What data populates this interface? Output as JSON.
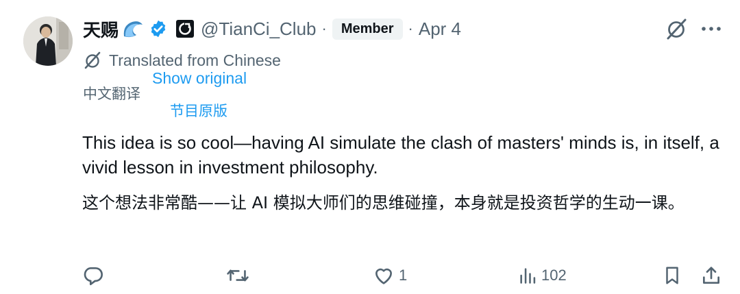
{
  "author": {
    "display_name": "天赐",
    "handle": "@TianCi_Club",
    "badge_label": "Member",
    "date": "Apr 4",
    "separator": "·"
  },
  "translation": {
    "status": "Translated from Chinese",
    "source_language": "中文翻译",
    "show_original": "Show original",
    "show_original_zh": "节目原版"
  },
  "content": {
    "translated_text": "This idea is so cool—having AI simulate the clash of masters' minds is, in itself, a vivid lesson in investment philosophy.",
    "original_text": "这个想法非常酷——让 AI 模拟大师们的思维碰撞，本身就是投资哲学的生动一课。"
  },
  "actions": {
    "reply_count": "",
    "retweet_count": "",
    "like_count": "1",
    "view_count": "102"
  },
  "icons": {
    "reply": "reply-icon",
    "retweet": "retweet-icon",
    "like": "heart-icon",
    "views": "views-icon",
    "bookmark": "bookmark-icon",
    "share": "share-icon",
    "grok": "grok-icon",
    "more": "more-icon",
    "verified": "verified-badge-icon",
    "emoji": "wave-emoji-icon",
    "affiliate": "affiliate-logo-icon",
    "translate": "translate-icon"
  },
  "colors": {
    "text": "#0f1419",
    "secondary": "#536471",
    "link": "#1d9bf0",
    "badge_bg": "#eff3f4"
  }
}
